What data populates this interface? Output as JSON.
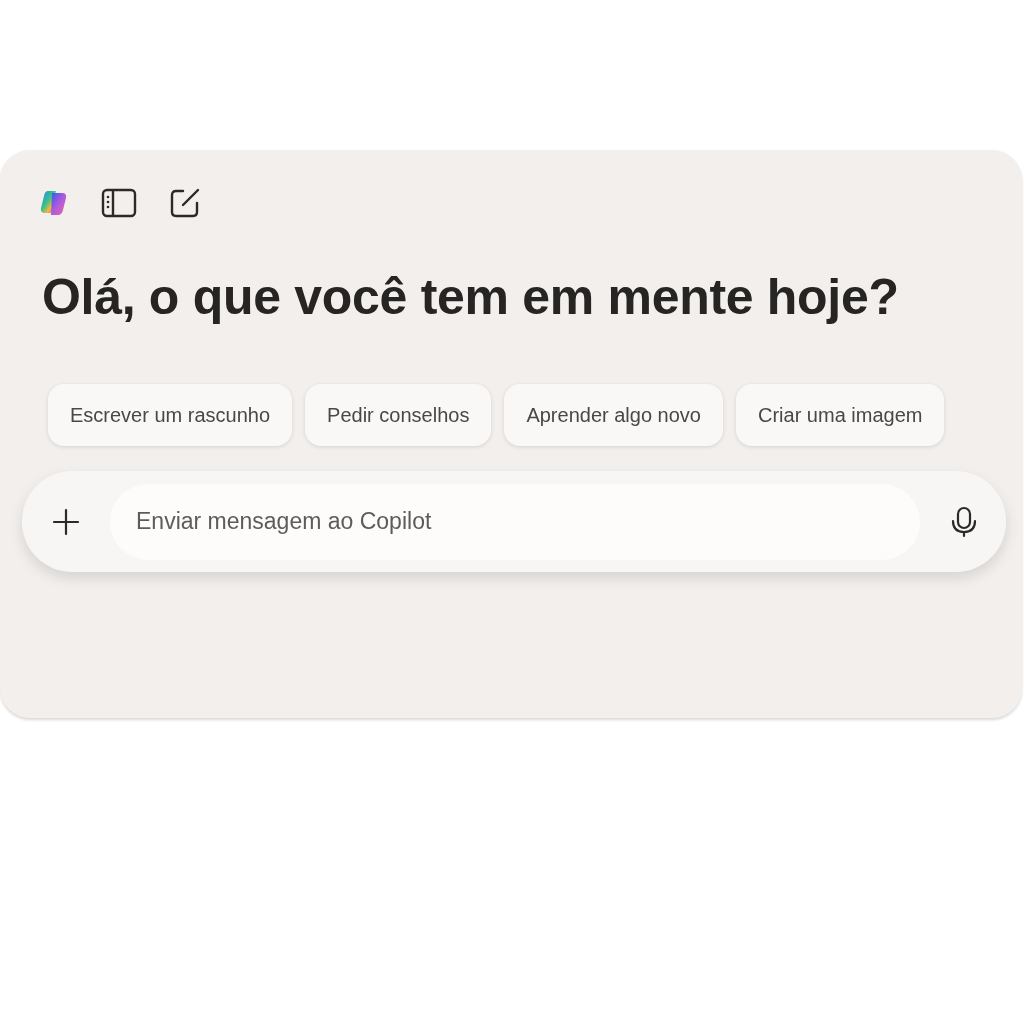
{
  "heading": "Olá, o que você tem em mente hoje?",
  "suggestions": [
    {
      "label": "Escrever um rascunho"
    },
    {
      "label": "Pedir conselhos"
    },
    {
      "label": "Aprender algo novo"
    },
    {
      "label": "Criar uma imagem"
    }
  ],
  "composer": {
    "placeholder": "Enviar mensagem ao Copilot"
  }
}
